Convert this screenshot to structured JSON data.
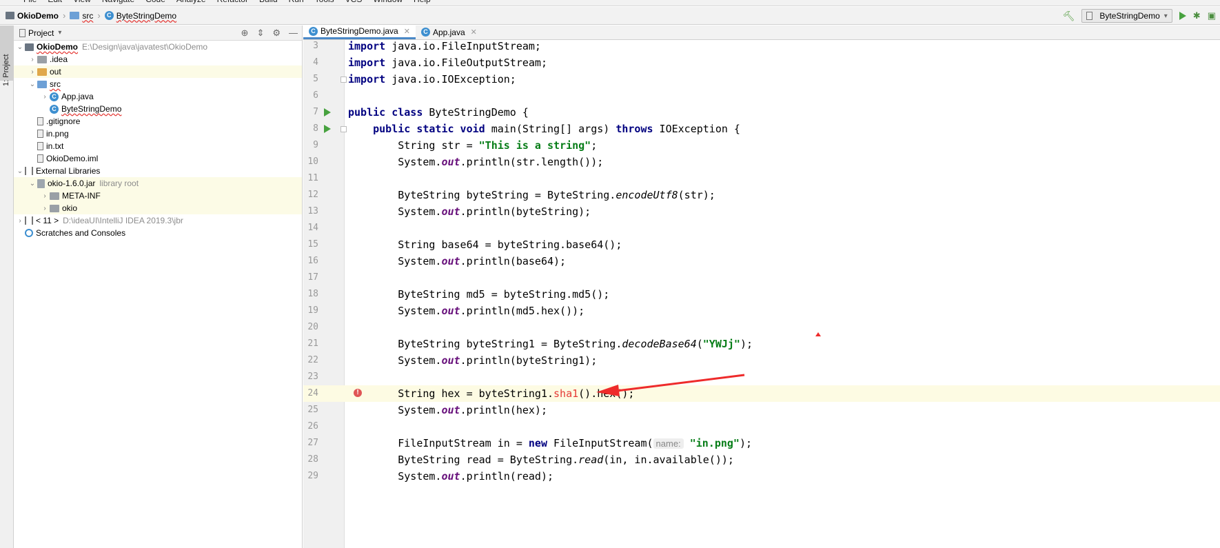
{
  "menubar": {
    "items": [
      "File",
      "Edit",
      "View",
      "Navigate",
      "Code",
      "Analyze",
      "Refactor",
      "Build",
      "Run",
      "Tools",
      "VCS",
      "Window",
      "Help"
    ]
  },
  "navbar": {
    "project": "OkioDemo",
    "folder": "src",
    "file": "ByteStringDemo",
    "run_config": "ByteStringDemo"
  },
  "tool_stripe": {
    "label": "1: Project"
  },
  "panel": {
    "title": "Project"
  },
  "tree": [
    {
      "label": "OkioDemo",
      "hint": "E:\\Design\\java\\javatest\\OkioDemo",
      "depth": 0,
      "chev": "down",
      "icon": "project",
      "bold": true,
      "wavy": true
    },
    {
      "label": ".idea",
      "depth": 1,
      "chev": "right",
      "icon": "folder-gray"
    },
    {
      "label": "out",
      "depth": 1,
      "chev": "right",
      "icon": "folder-orange",
      "hl": true
    },
    {
      "label": "src",
      "depth": 1,
      "chev": "down",
      "icon": "folder-blue",
      "wavy": true
    },
    {
      "label": "App.java",
      "depth": 2,
      "chev": "right",
      "icon": "class"
    },
    {
      "label": "ByteStringDemo",
      "depth": 2,
      "chev": "",
      "icon": "class",
      "wavy": true
    },
    {
      "label": ".gitignore",
      "depth": 1,
      "chev": "",
      "icon": "file"
    },
    {
      "label": "in.png",
      "depth": 1,
      "chev": "",
      "icon": "file"
    },
    {
      "label": "in.txt",
      "depth": 1,
      "chev": "",
      "icon": "file"
    },
    {
      "label": "OkioDemo.iml",
      "depth": 1,
      "chev": "",
      "icon": "file"
    },
    {
      "label": "External Libraries",
      "depth": 0,
      "chev": "down",
      "icon": "lib"
    },
    {
      "label": "okio-1.6.0.jar",
      "hint": "library root",
      "depth": 1,
      "chev": "down",
      "icon": "jar",
      "hl": true
    },
    {
      "label": "META-INF",
      "depth": 2,
      "chev": "right",
      "icon": "folder-gray",
      "hl": true
    },
    {
      "label": "okio",
      "depth": 2,
      "chev": "right",
      "icon": "folder-gray",
      "hl": true
    },
    {
      "label": "< 11 >",
      "hint": "D:\\ideaUI\\IntelliJ IDEA 2019.3\\jbr",
      "depth": 0,
      "chev": "right",
      "icon": "lib"
    },
    {
      "label": "Scratches and Consoles",
      "depth": 0,
      "chev": "",
      "icon": "scratch"
    }
  ],
  "editor_tabs": [
    {
      "label": "ByteStringDemo.java",
      "active": true
    },
    {
      "label": "App.java",
      "active": false
    }
  ],
  "code_lines": [
    {
      "n": "3",
      "tokens": [
        [
          "kw",
          "import"
        ],
        [
          "",
          " java.io.FileInputStream;"
        ]
      ]
    },
    {
      "n": "4",
      "tokens": [
        [
          "kw",
          "import"
        ],
        [
          "",
          " java.io.FileOutputStream;"
        ]
      ]
    },
    {
      "n": "5",
      "tokens": [
        [
          "kw",
          "import"
        ],
        [
          "",
          " java.io.IOException;"
        ]
      ],
      "fold": true
    },
    {
      "n": "6",
      "tokens": []
    },
    {
      "n": "7",
      "tokens": [
        [
          "kw",
          "public class"
        ],
        [
          "",
          " ByteStringDemo {"
        ]
      ],
      "run": true
    },
    {
      "n": "8",
      "tokens": [
        [
          "",
          "    "
        ],
        [
          "kw",
          "public static void"
        ],
        [
          "",
          " main(String[] args) "
        ],
        [
          "kw",
          "throws"
        ],
        [
          "",
          " IOException {"
        ]
      ],
      "run": true,
      "fold": true
    },
    {
      "n": "9",
      "tokens": [
        [
          "",
          "        String str = "
        ],
        [
          "str",
          "\"This is a string\""
        ],
        [
          "",
          ";"
        ]
      ]
    },
    {
      "n": "10",
      "tokens": [
        [
          "",
          "        System."
        ],
        [
          "fld",
          "out"
        ],
        [
          "",
          ".println(str.length());"
        ]
      ]
    },
    {
      "n": "11",
      "tokens": []
    },
    {
      "n": "12",
      "tokens": [
        [
          "",
          "        ByteString byteString = ByteString."
        ],
        [
          "ital",
          "encodeUtf8"
        ],
        [
          "",
          "(str);"
        ]
      ]
    },
    {
      "n": "13",
      "tokens": [
        [
          "",
          "        System."
        ],
        [
          "fld",
          "out"
        ],
        [
          "",
          ".println(byteString);"
        ]
      ]
    },
    {
      "n": "14",
      "tokens": []
    },
    {
      "n": "15",
      "tokens": [
        [
          "",
          "        String base64 = byteString.base64();"
        ]
      ]
    },
    {
      "n": "16",
      "tokens": [
        [
          "",
          "        System."
        ],
        [
          "fld",
          "out"
        ],
        [
          "",
          ".println(base64);"
        ]
      ]
    },
    {
      "n": "17",
      "tokens": []
    },
    {
      "n": "18",
      "tokens": [
        [
          "",
          "        ByteString md5 = byteString.md5();"
        ]
      ]
    },
    {
      "n": "19",
      "tokens": [
        [
          "",
          "        System."
        ],
        [
          "fld",
          "out"
        ],
        [
          "",
          ".println(md5.hex());"
        ]
      ]
    },
    {
      "n": "20",
      "tokens": []
    },
    {
      "n": "21",
      "tokens": [
        [
          "",
          "        ByteString byteString1 = ByteString."
        ],
        [
          "ital",
          "decodeBase64"
        ],
        [
          "",
          "("
        ],
        [
          "str",
          "\"YWJj\""
        ],
        [
          "",
          ");"
        ]
      ]
    },
    {
      "n": "22",
      "tokens": [
        [
          "",
          "        System."
        ],
        [
          "fld",
          "out"
        ],
        [
          "",
          ".println(byteString1);"
        ]
      ]
    },
    {
      "n": "23",
      "tokens": []
    },
    {
      "n": "24",
      "tokens": [
        [
          "",
          "        String hex = byteString1."
        ],
        [
          "err",
          "sha1"
        ],
        [
          "",
          "().hex();"
        ]
      ],
      "current": true,
      "error": true
    },
    {
      "n": "25",
      "tokens": [
        [
          "",
          "        System."
        ],
        [
          "fld",
          "out"
        ],
        [
          "",
          ".println(hex);"
        ]
      ]
    },
    {
      "n": "26",
      "tokens": []
    },
    {
      "n": "27",
      "tokens": [
        [
          "",
          "        FileInputStream in = "
        ],
        [
          "kw",
          "new"
        ],
        [
          "",
          " FileInputStream("
        ],
        [
          "hint",
          "name:"
        ],
        [
          "",
          " "
        ],
        [
          "str",
          "\"in.png\""
        ],
        [
          "",
          ");"
        ]
      ]
    },
    {
      "n": "28",
      "tokens": [
        [
          "",
          "        ByteString read = ByteString."
        ],
        [
          "ital",
          "read"
        ],
        [
          "",
          "(in, in.available());"
        ]
      ]
    },
    {
      "n": "29",
      "tokens": [
        [
          "",
          "        System."
        ],
        [
          "fld",
          "out"
        ],
        [
          "",
          ".println(read);"
        ]
      ]
    }
  ],
  "colors": {
    "accent": "#4a88c7",
    "annotation_red": "#ee2b2b",
    "keyword": "#000080",
    "string": "#067d17"
  }
}
